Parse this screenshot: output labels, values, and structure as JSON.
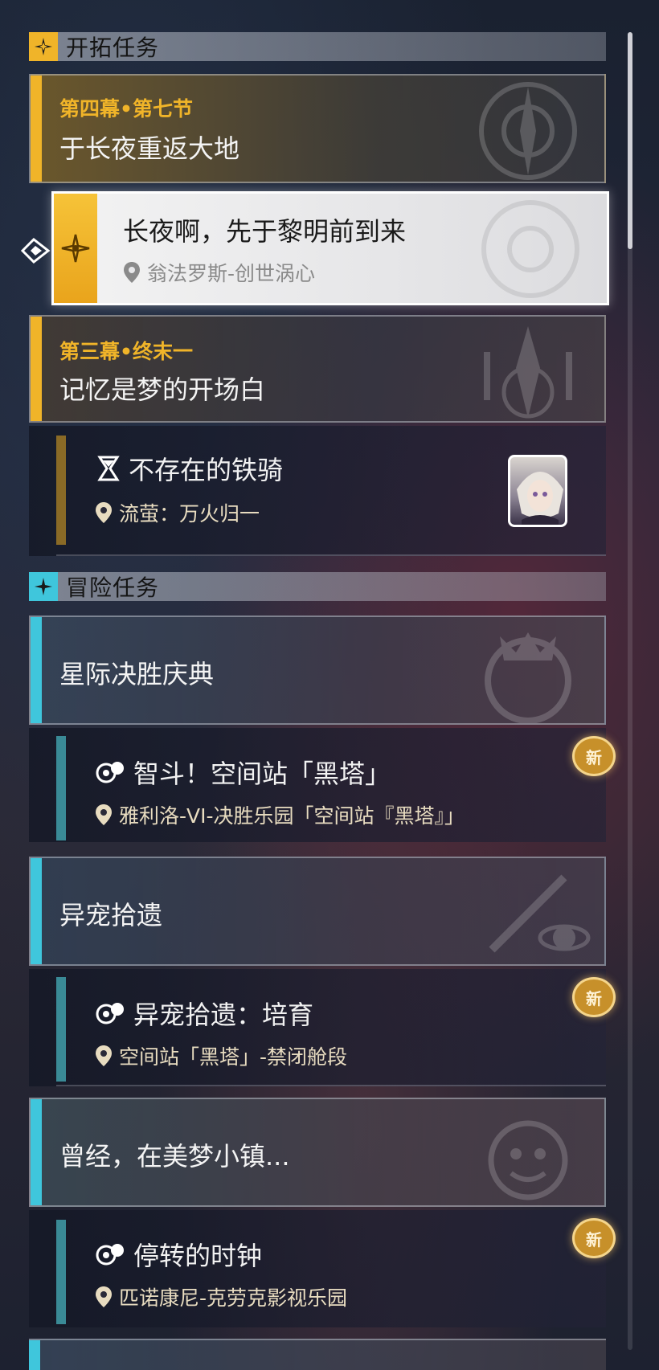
{
  "colors": {
    "trailblaze_accent": "#f0b429",
    "adventure_accent": "#3fc6dc",
    "kicker_gold": "#f0b429",
    "location_text": "#e8dcc0"
  },
  "sections": {
    "trailblaze": {
      "title": "开拓任务",
      "icon": "trailblaze-star-icon"
    },
    "adventure": {
      "title": "冒险任务",
      "icon": "adventure-star-icon"
    }
  },
  "trailblaze": {
    "chapter1": {
      "kicker": "第四幕•第七节",
      "title": "于长夜重返大地"
    },
    "tracked": {
      "title": "长夜啊，先于黎明前到来",
      "location": "翁法罗斯-创世涡心"
    },
    "chapter2": {
      "kicker": "第三幕•终末一",
      "title": "记忆是梦的开场白"
    },
    "sub1": {
      "title": "不存在的铁骑",
      "location": "流萤：万火归一",
      "icon": "hourglass-icon"
    }
  },
  "adventure": {
    "group1": {
      "title": "星际决胜庆典"
    },
    "quest1": {
      "title": "智斗！空间站「黑塔」",
      "location": "雅利洛-VI-决胜乐园「空间站『黑塔』」",
      "badge": "新"
    },
    "group2": {
      "title": "异宠拾遗"
    },
    "quest2": {
      "title": "异宠拾遗：培育",
      "location": "空间站「黑塔」-禁闭舱段",
      "badge": "新"
    },
    "group3": {
      "title": "曾经，在美梦小镇..."
    },
    "quest3": {
      "title": "停转的时钟",
      "location": "匹诺康尼-克劳克影视乐园",
      "badge": "新"
    }
  }
}
